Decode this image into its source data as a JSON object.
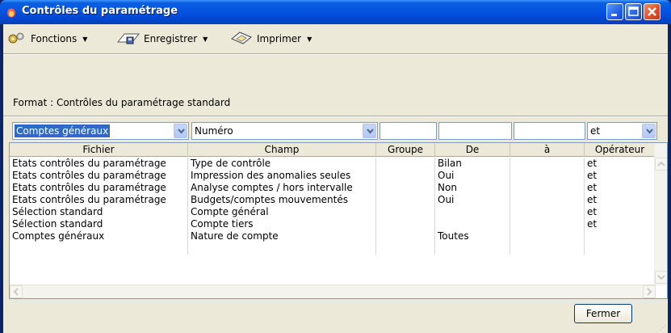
{
  "window": {
    "title": "Contrôles du paramétrage"
  },
  "toolbar": {
    "fonctions_label": "Fonctions",
    "enregistrer_label": "Enregistrer",
    "imprimer_label": "Imprimer"
  },
  "format_text": "Format : Contrôles du paramétrage standard",
  "filters": {
    "fichier_value": "Comptes généraux",
    "champ_value": "Numéro",
    "groupe_value": "",
    "de_value": "",
    "a_value": "",
    "operateur_value": "et"
  },
  "grid": {
    "headers": [
      "Fichier",
      "Champ",
      "Groupe",
      "De",
      "à",
      "Opérateur"
    ],
    "rows": [
      [
        "Etats contrôles du paramétrage",
        "Type de contrôle",
        "",
        "Bilan",
        "",
        "et"
      ],
      [
        "Etats contrôles du paramétrage",
        "Impression des anomalies seules",
        "",
        "Oui",
        "",
        "et"
      ],
      [
        "Etats contrôles du paramétrage",
        "Analyse comptes / hors intervalle",
        "",
        "Non",
        "",
        "et"
      ],
      [
        "Etats contrôles du paramétrage",
        "Budgets/comptes mouvementés",
        "",
        "Oui",
        "",
        "et"
      ],
      [
        "Sélection standard",
        "Compte général",
        "",
        "",
        "",
        "et"
      ],
      [
        "Sélection standard",
        "Compte tiers",
        "",
        "",
        "",
        "et"
      ],
      [
        "Comptes généraux",
        "Nature de compte",
        "",
        "Toutes",
        "",
        ""
      ]
    ]
  },
  "footer": {
    "fermer_label": "Fermer"
  },
  "colors": {
    "title_bar": "#0554e3",
    "selection": "#316ac5",
    "close_button": "#e2512a",
    "window_bg": "#ece9d8"
  },
  "icons": {
    "title": "app-flame-icon",
    "fonctions": "gears-icon",
    "enregistrer": "save-folder-icon",
    "imprimer": "print-icon"
  }
}
